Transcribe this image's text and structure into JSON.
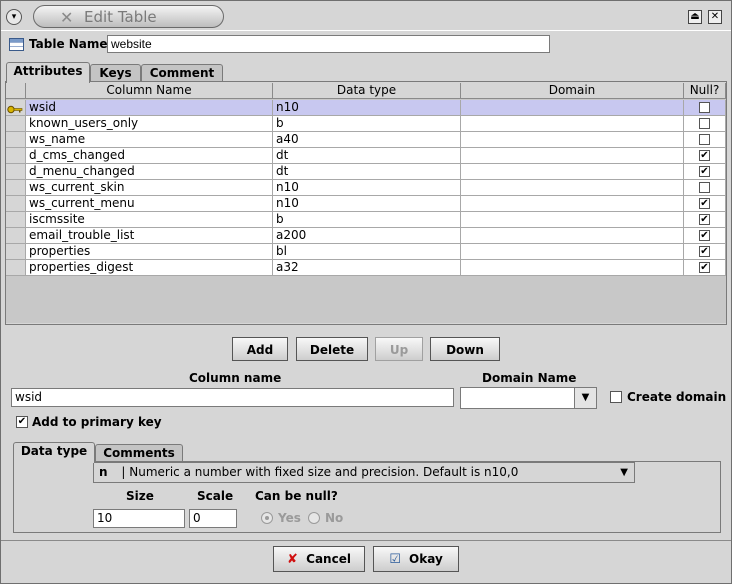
{
  "window": {
    "title": "Edit Table",
    "menu_icon": "chevron-down-icon",
    "title_icon": "x-mark-icon",
    "restore_icon": "eject-icon",
    "close_icon": "close-icon"
  },
  "table_name": {
    "label": "Table Name",
    "value": "website"
  },
  "tabs": [
    {
      "label": "Attributes"
    },
    {
      "label": "Keys"
    },
    {
      "label": "Comment"
    }
  ],
  "grid": {
    "headers": [
      "Column Name",
      "Data type",
      "Domain",
      "Null?"
    ],
    "rows": [
      {
        "name": "wsid",
        "type": "n10",
        "domain": "",
        "nullable": false,
        "primary_key": true
      },
      {
        "name": "known_users_only",
        "type": "b",
        "domain": "",
        "nullable": false,
        "primary_key": false
      },
      {
        "name": "ws_name",
        "type": "a40",
        "domain": "",
        "nullable": false,
        "primary_key": false
      },
      {
        "name": "d_cms_changed",
        "type": "dt",
        "domain": "",
        "nullable": true,
        "primary_key": false
      },
      {
        "name": "d_menu_changed",
        "type": "dt",
        "domain": "",
        "nullable": true,
        "primary_key": false
      },
      {
        "name": "ws_current_skin",
        "type": "n10",
        "domain": "",
        "nullable": false,
        "primary_key": false
      },
      {
        "name": "ws_current_menu",
        "type": "n10",
        "domain": "",
        "nullable": true,
        "primary_key": false
      },
      {
        "name": "iscmssite",
        "type": "b",
        "domain": "",
        "nullable": true,
        "primary_key": false
      },
      {
        "name": "email_trouble_list",
        "type": "a200",
        "domain": "",
        "nullable": true,
        "primary_key": false
      },
      {
        "name": "properties",
        "type": "bl",
        "domain": "",
        "nullable": true,
        "primary_key": false
      },
      {
        "name": "properties_digest",
        "type": "a32",
        "domain": "",
        "nullable": true,
        "primary_key": false
      }
    ]
  },
  "row_buttons": {
    "add": "Add",
    "delete": "Delete",
    "up": "Up",
    "down": "Down"
  },
  "column_editor": {
    "column_name_label": "Column name",
    "column_name_value": "wsid",
    "domain_name_label": "Domain Name",
    "domain_name_value": "",
    "create_domain_label": "Create domain",
    "add_primary_key_label": "Add to primary key",
    "add_primary_key_checked": true
  },
  "sub_tabs": [
    {
      "label": "Data type"
    },
    {
      "label": "Comments"
    }
  ],
  "data_type": {
    "code": "n",
    "description": "| Numeric a number with fixed size and precision. Default is n10,0",
    "size_label": "Size",
    "size_value": "10",
    "scale_label": "Scale",
    "scale_value": "0",
    "null_label": "Can be null?",
    "yes_label": "Yes",
    "no_label": "No"
  },
  "footer": {
    "cancel": "Cancel",
    "okay": "Okay"
  }
}
